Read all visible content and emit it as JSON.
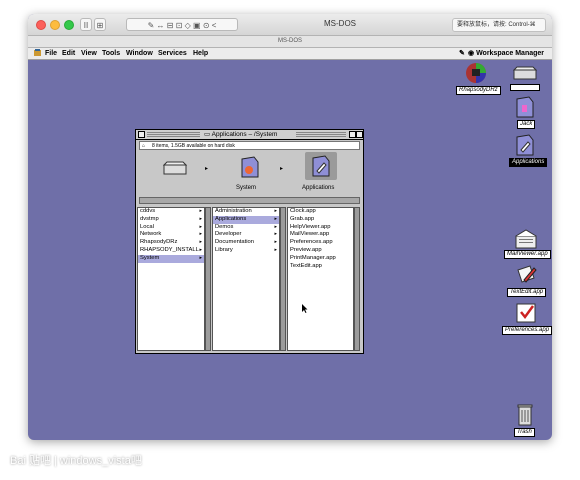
{
  "window": {
    "title": "MS-DOS",
    "tab_title": "MS-DOS",
    "keyboard_hint": "要释放鼠标，请按: Control-⌘",
    "toolbar_buttons": [
      "II",
      "⊞",
      "✎",
      "↔",
      "⊟",
      "⊡",
      "◇",
      "▣",
      "⊙",
      "<"
    ]
  },
  "menubar": {
    "items": [
      "File",
      "Edit",
      "View",
      "Tools",
      "Window",
      "Services",
      "Help"
    ],
    "workspace": "Workspace Manager"
  },
  "desktop_icons": [
    {
      "name": "rhapsody-drive",
      "label": "RhapsodyDRz",
      "selected": false
    },
    {
      "name": "blank-drive",
      "label": "",
      "selected": false
    },
    {
      "name": "jack-folder",
      "label": "Jack",
      "selected": false
    },
    {
      "name": "applications-folder",
      "label": "Applications",
      "selected": true
    },
    {
      "name": "mailviewer-app",
      "label": "MailViewer.app",
      "selected": false
    },
    {
      "name": "textedit-app",
      "label": "TextEdit.app",
      "selected": false
    },
    {
      "name": "preferences-app",
      "label": "Preferences.app",
      "selected": false
    },
    {
      "name": "trash",
      "label": "Trash",
      "selected": false
    }
  ],
  "finder": {
    "title": "Applications – /System",
    "status": "8 items, 1.5GB available on hard disk",
    "shelf": [
      {
        "label": ""
      },
      {
        "label": "System"
      },
      {
        "label": "Applications"
      }
    ],
    "col1": [
      {
        "label": "cddvs",
        "arrow": true,
        "selected": false
      },
      {
        "label": "dvstmp",
        "arrow": true,
        "selected": false
      },
      {
        "label": "Local",
        "arrow": true,
        "selected": false
      },
      {
        "label": "Network",
        "arrow": true,
        "selected": false
      },
      {
        "label": "RhapsodyDRz",
        "arrow": true,
        "selected": false
      },
      {
        "label": "RHAPSODY_INSTALL",
        "arrow": true,
        "selected": false
      },
      {
        "label": "System",
        "arrow": true,
        "selected": true
      }
    ],
    "col2": [
      {
        "label": "Administration",
        "arrow": true,
        "selected": false
      },
      {
        "label": "Applications",
        "arrow": true,
        "selected": true
      },
      {
        "label": "Demos",
        "arrow": true,
        "selected": false
      },
      {
        "label": "Developer",
        "arrow": true,
        "selected": false
      },
      {
        "label": "Documentation",
        "arrow": true,
        "selected": false
      },
      {
        "label": "Library",
        "arrow": true,
        "selected": false
      }
    ],
    "col3": [
      {
        "label": "Clock.app"
      },
      {
        "label": "Grab.app"
      },
      {
        "label": "HelpViewer.app"
      },
      {
        "label": "MailViewer.app"
      },
      {
        "label": "Preferences.app"
      },
      {
        "label": "Preview.app"
      },
      {
        "label": "PrintManager.app"
      },
      {
        "label": "TextEdit.app"
      }
    ]
  },
  "watermark": "Bai 贴吧 | windows_vista吧",
  "colors": {
    "desktop": "#6f6fa8",
    "selection": "#aaaadd"
  }
}
